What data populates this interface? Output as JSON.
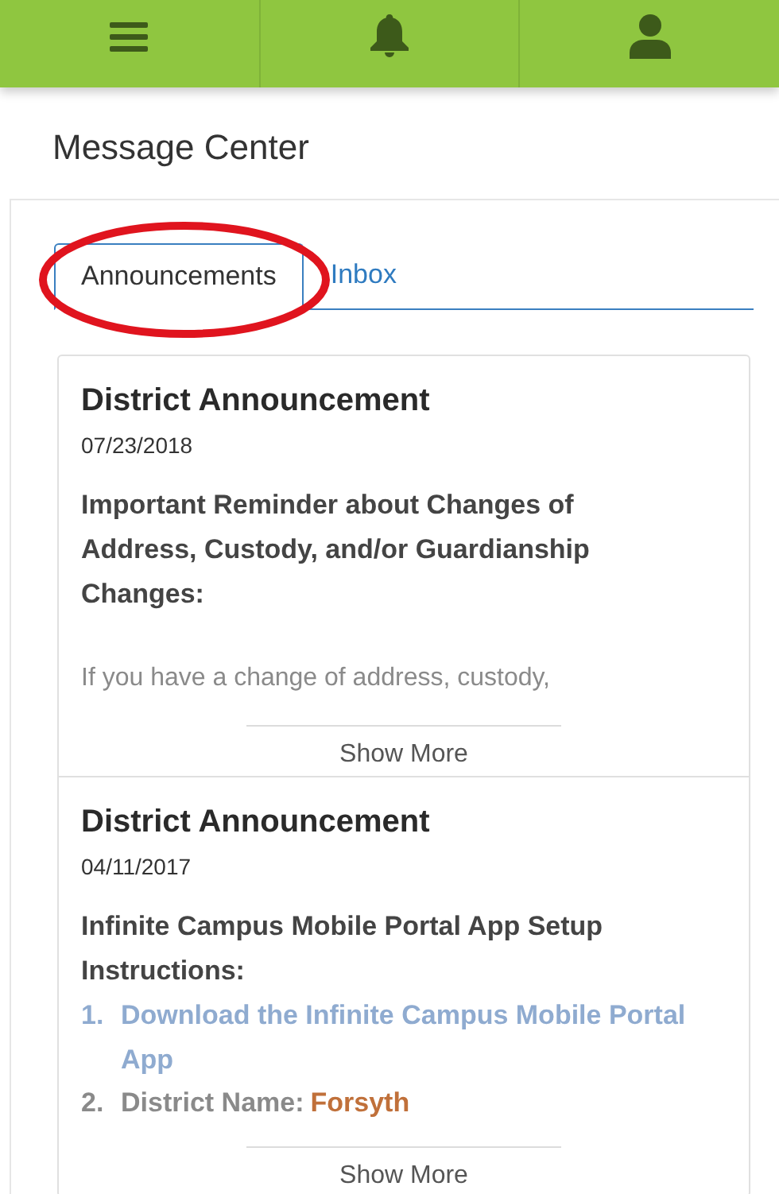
{
  "page_title": "Message Center",
  "tabs": [
    {
      "label": "Announcements",
      "selected": true,
      "circled": true
    },
    {
      "label": "Inbox",
      "selected": false,
      "circled": false
    }
  ],
  "announcements": [
    {
      "title": "District Announcement",
      "date": "07/23/2018",
      "body": [
        {
          "kind": "heading",
          "text": "Important Reminder about Changes of Address, Custody, and/or Guardianship Changes:"
        },
        {
          "kind": "faded",
          "text": "If you have a change of address, custody,"
        }
      ],
      "show_more": "Show More"
    },
    {
      "title": "District Announcement",
      "date": "04/11/2017",
      "body": [
        {
          "kind": "heading",
          "text": "Infinite Campus Mobile Portal App Setup Instructions:"
        },
        {
          "kind": "list_item",
          "number": "1.",
          "text": "Download the Infinite Campus Mobile Portal App"
        },
        {
          "kind": "faded_item",
          "number": "2.",
          "text": "District Name:",
          "value": "Forsyth"
        }
      ],
      "show_more": "Show More"
    }
  ]
}
